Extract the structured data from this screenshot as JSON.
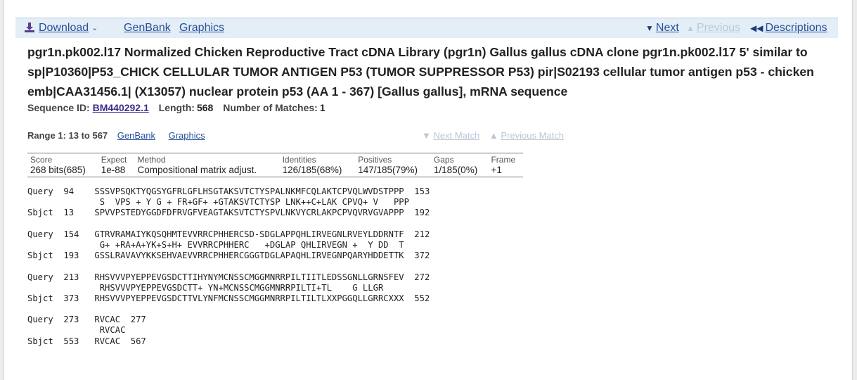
{
  "toolbar": {
    "download_label": "Download",
    "genbank_label": "GenBank",
    "graphics_label": "Graphics",
    "next_label": "Next",
    "previous_label": "Previous",
    "descriptions_label": "Descriptions"
  },
  "title": "pgr1n.pk002.l17 Normalized Chicken Reproductive Tract cDNA Library (pgr1n) Gallus gallus cDNA clone pgr1n.pk002.l17 5' similar to sp|P10360|P53_CHICK CELLULAR TUMOR ANTIGEN P53 (TUMOR SUPPRESSOR P53) pir|S02193 cellular tumor antigen p53 - chicken emb|CAA31456.1| (X13057) nuclear protein p53 (AA 1 - 367) [Gallus gallus], mRNA sequence",
  "sequence": {
    "id_label": "Sequence ID:",
    "id_value": "BM440292.1",
    "length_label": "Length:",
    "length_value": "568",
    "matches_label": "Number of Matches:",
    "matches_value": "1"
  },
  "range": {
    "label": "Range 1: 13 to 567",
    "genbank_label": "GenBank",
    "graphics_label": "Graphics",
    "next_match_label": "Next Match",
    "previous_match_label": "Previous Match"
  },
  "stats": {
    "headers": [
      "Score",
      "Expect",
      "Method",
      "Identities",
      "Positives",
      "Gaps",
      "Frame"
    ],
    "values": [
      "268 bits(685)",
      "1e-88",
      "Compositional matrix adjust.",
      "126/185(68%)",
      "147/185(79%)",
      "1/185(0%)",
      "+1"
    ]
  },
  "alignment": [
    {
      "query": "Query  94    SSSVPSQKTYQGSYGFRLGFLHSGTAKSVTCTYSPALNKMFCQLAKTCPVQLWVDSTPPP  153",
      "middle": "              S  VPS + Y G + FR+GF+ +GTAKSVTCTYSP LNK++C+LAK CPVQ+ V   PPP",
      "sbjct": "Sbjct  13    SPVVPSTEDYGGDFDFRVGFVEAGTAKSVTCTYSPVLNKVYCRLAKPCPVQVRVGVAPPP  192"
    },
    {
      "query": "Query  154   GTRVRAMAIYKQSQHMTEVVRRCPHHERCSD-SDGLAPPQHLIRVEGNLRVEYLDDRNTF  212",
      "middle": "              G+ +RA+A+YK+S+H+ EVVRRCPHHERC   +DGLAP QHLIRVEGN +  Y DD  T",
      "sbjct": "Sbjct  193   GSSLRAVAVYKKSEHVAEVVRRCPHHERCGGGTDGLAPAQHLIRVEGNPQARYHDDETTK  372"
    },
    {
      "query": "Query  213   RHSVVVPYEPPEVGSDCTTIHYNYMCNSSCMGGMNRRPILTIITLEDSSGNLLGRNSFEV  272",
      "middle": "              RHSVVVPYEPPEVGSDCTT+ YN+MCNSSCMGGMNRRPILTI+TL    G LLGR",
      "sbjct": "Sbjct  373   RHSVVVPYEPPEVGSDCTTVLYNFMCNSSCMGGMNRRPILTILTLXXPGGQLLGRRCXXX  552"
    },
    {
      "query": "Query  273   RVCAC  277",
      "middle": "              RVCAC",
      "sbjct": "Sbjct  553   RVCAC  567"
    }
  ],
  "colors": {
    "link": "#29509a",
    "visited_link": "#3a2d8c",
    "disabled": "#bcc9d6",
    "toolbar_bg": "#e3eef7"
  }
}
